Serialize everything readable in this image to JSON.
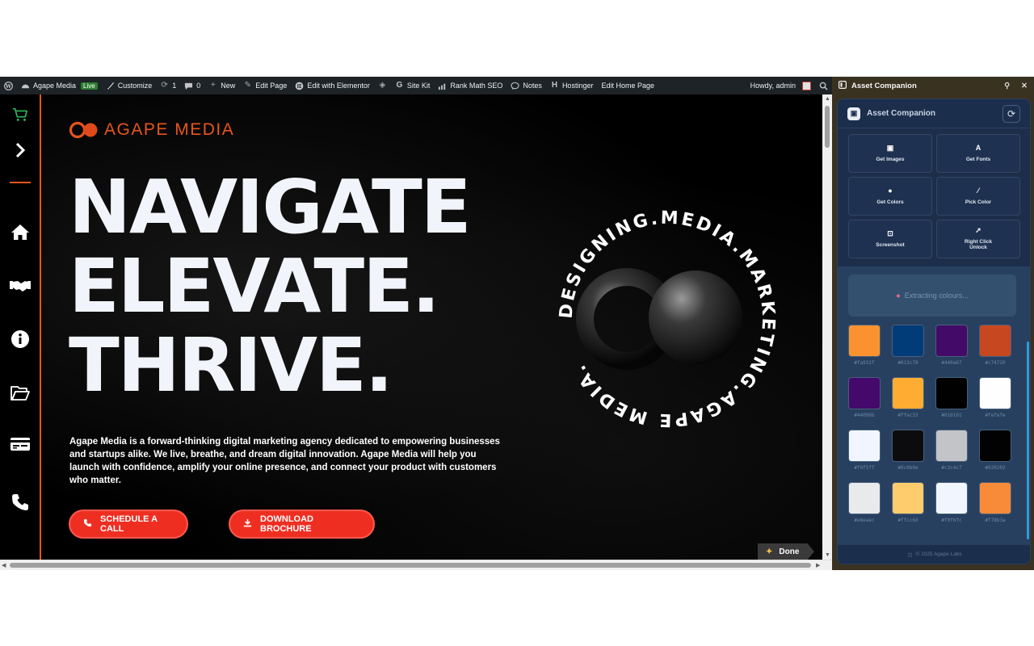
{
  "admin_bar": {
    "site_name": "Agape Media",
    "live_badge": "Live",
    "customize": "Customize",
    "updates_count": "1",
    "comments_count": "0",
    "new": "New",
    "edit_page": "Edit Page",
    "edit_elementor": "Edit with Elementor",
    "site_kit": "Site Kit",
    "rank_math": "Rank Math SEO",
    "notes": "Notes",
    "hostinger": "Hostinger",
    "edit_home": "Edit Home Page",
    "howdy": "Howdy, admin"
  },
  "site": {
    "logo_text": "AGAPE MEDIA",
    "hero_lines": [
      "NAVIGATE",
      "ELEVATE.",
      "THRIVE."
    ],
    "blurb": "Agape Media is a forward-thinking digital marketing agency dedicated to empowering businesses and startups alike. We live, breathe, and dream digital innovation. Agape Media will help you launch with confidence, amplify your online presence, and connect your product with customers who matter.",
    "cta_primary": "SCHEDULE A CALL",
    "cta_secondary": "DOWNLOAD BROCHURE",
    "circular_text": "DESIGNING.MEDIA.MARKETING.AGAPE MEDIA.",
    "done_label": "Done",
    "accent_color": "#e8541c",
    "cta_color": "#ef2e22"
  },
  "sidebar_icons": [
    "cart-icon",
    "chevron-right-icon",
    "home-icon",
    "handshake-icon",
    "info-icon",
    "folder-icon",
    "card-icon",
    "phone-icon"
  ],
  "extension": {
    "window_title": "Asset Companion",
    "panel_title": "Asset Companion",
    "tools": [
      "Get Images",
      "Get Fonts",
      "Get Colors",
      "Pick Color",
      "Screenshot",
      "Right Click Unlock"
    ],
    "extracting_text": "Extracting colours...",
    "swatches": [
      {
        "hex": "#fa932f",
        "label": "#fa932f"
      },
      {
        "hex": "#013c78",
        "label": "#013c78"
      },
      {
        "hex": "#440a67",
        "label": "#440a67"
      },
      {
        "hex": "#c74720",
        "label": "#c74720"
      },
      {
        "hex": "#44096b",
        "label": "#44096b"
      },
      {
        "hex": "#ffac33",
        "label": "#ffac33"
      },
      {
        "hex": "#010101",
        "label": "#010101"
      },
      {
        "hex": "#fefefe",
        "label": "#fefefe"
      },
      {
        "hex": "#f0f5ff",
        "label": "#f0f5ff"
      },
      {
        "hex": "#0c0b0e",
        "label": "#0c0b0e"
      },
      {
        "hex": "#c3c4c7",
        "label": "#c3c4c7"
      },
      {
        "hex": "#020202",
        "label": "#020202"
      },
      {
        "hex": "#e8eaec",
        "label": "#e8eaec"
      },
      {
        "hex": "#ffcc6d",
        "label": "#ffcc6d"
      },
      {
        "hex": "#f0f6fc",
        "label": "#f0f6fc"
      },
      {
        "hex": "#f78b3a",
        "label": "#f78b3a"
      }
    ],
    "footer": "© 2025 Agape Labs"
  }
}
